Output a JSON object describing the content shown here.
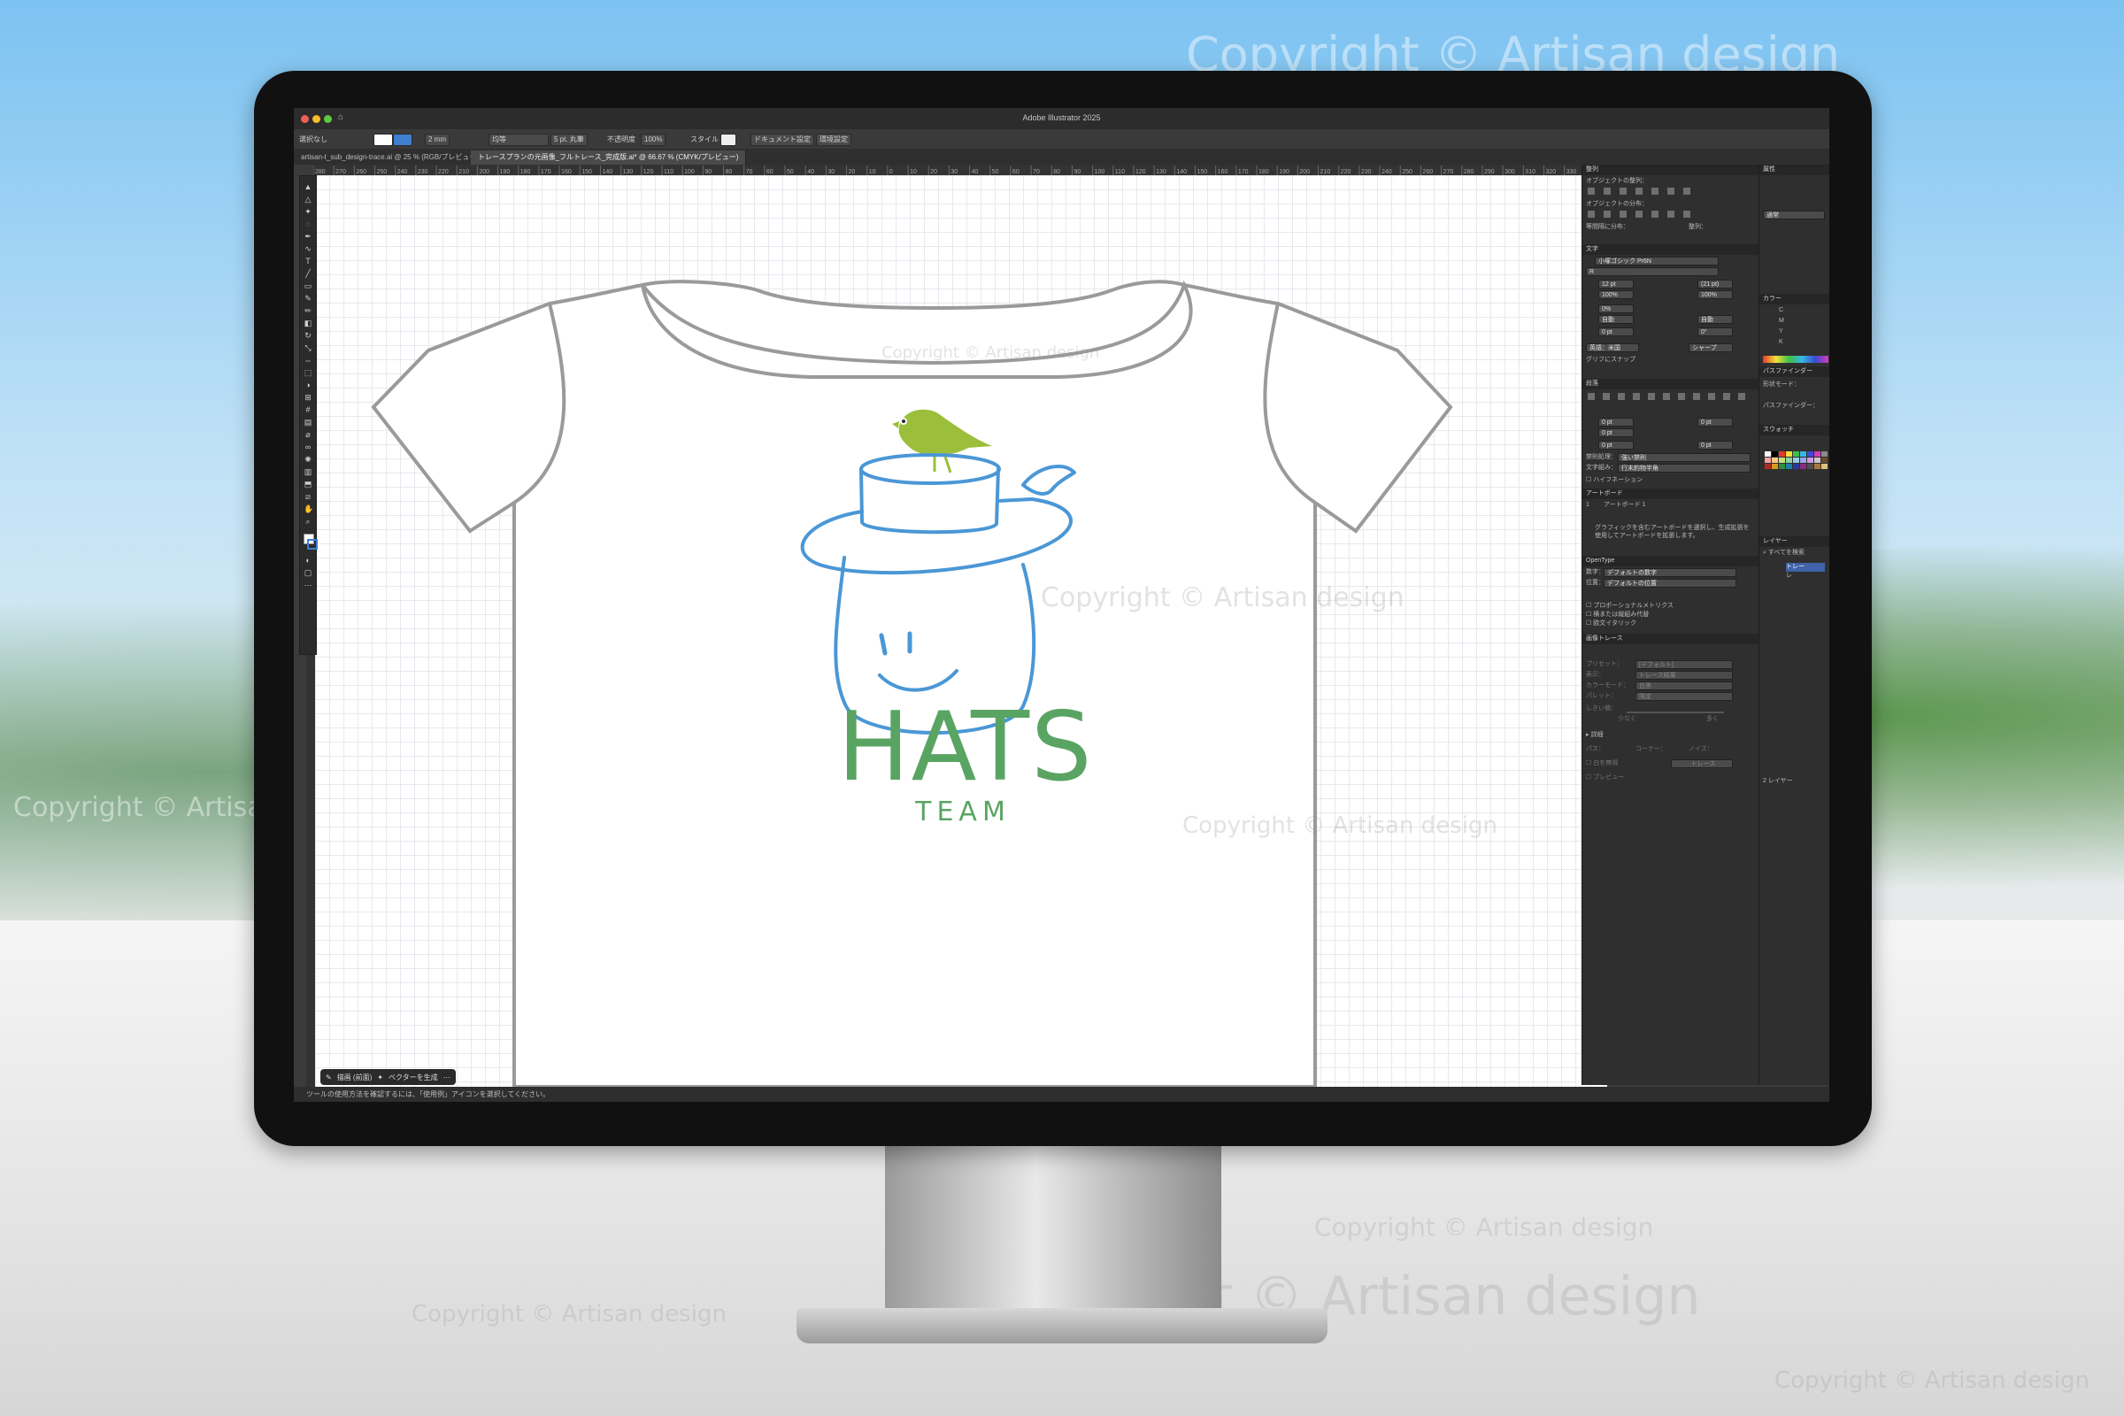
{
  "watermark": "Copyright © Artisan design",
  "app": {
    "window_title": "Adobe Illustrator 2025",
    "control_bar": {
      "selection": "選択なし",
      "stroke_weight": "2 mm",
      "stroke_style": "均等",
      "brush": "5 pt. 丸筆",
      "opacity_label": "不透明度",
      "opacity_value": "100%",
      "style_label": "スタイル",
      "doc_setup": "ドキュメント設定",
      "preferences": "環境設定"
    },
    "tabs": [
      {
        "label": "artisan-t_sub_design-trace.ai @ 25 % (RGB/プレビュー)"
      },
      {
        "label": "トレースプランの元画像_フルトレース_完成版.ai* @ 66.67 % (CMYK/プレビュー)"
      }
    ],
    "ruler_labels": [
      "280",
      "270",
      "260",
      "250",
      "240",
      "230",
      "220",
      "210",
      "200",
      "190",
      "180",
      "170",
      "160",
      "150",
      "140",
      "130",
      "120",
      "110",
      "100",
      "90",
      "80",
      "70",
      "60",
      "50",
      "40",
      "30",
      "20",
      "10",
      "0",
      "10",
      "20",
      "30",
      "40",
      "50",
      "60",
      "70",
      "80",
      "90",
      "100",
      "110",
      "120",
      "130",
      "140",
      "150",
      "160",
      "170",
      "180",
      "190",
      "200",
      "210",
      "220",
      "230",
      "240",
      "250",
      "260",
      "270",
      "280",
      "290",
      "300",
      "310",
      "320",
      "330",
      "340"
    ],
    "artwork": {
      "title_text": "HATS",
      "subtitle_text": "TEAM",
      "colors": {
        "shirt_outline": "#9a9a9a",
        "hat_blue": "#4a97d6",
        "bird_green": "#9bbf3b",
        "text_green": "#5aa463"
      }
    },
    "bottom_bar": {
      "draw_label": "描画 (前面)",
      "vector_label": "ベクターを生成"
    },
    "status_text": "ツールの使用方法を確認するには、「使用例」アイコンを選択してください。",
    "panels": {
      "align": {
        "header": "整列",
        "objects_align": "オブジェクトの整列：",
        "objects_distribute": "オブジェクトの分布：",
        "distribute_spacing": "等間隔に分布：",
        "align_to": "整列："
      },
      "character": {
        "header": "文字",
        "font": "小塚ゴシック Pr6N",
        "style": "R",
        "size": "12 pt",
        "leading": "(21 pt)",
        "vscale": "100%",
        "hscale": "100%",
        "tsume": "0%",
        "kerning": "自動",
        "tracking_auto": "自動",
        "baseline": "0 pt",
        "rotation": "0°",
        "language": "英語：米国",
        "aa": "シャープ",
        "glyph_snap": "グリフにスナップ"
      },
      "paragraph": {
        "header": "段落",
        "indent1": "0 pt",
        "indent2": "0 pt",
        "indent3": "0 pt",
        "space1": "0 pt",
        "space2": "0 pt",
        "kinsoku_label": "禁則処理：",
        "kinsoku_value": "強い禁則",
        "mojikumi_label": "文字組み：",
        "mojikumi_value": "行末約物半角",
        "hyphenation": "ハイフネーション"
      },
      "artboards": {
        "header": "アートボード",
        "item_num": "1",
        "item_name": "アートボード 1",
        "hint": "グラフィックを含むアートボードを選択し、生成拡張を使用してアートボードを拡張します。"
      },
      "opentype": {
        "header": "OpenType",
        "numeral_label": "数字：",
        "numeral_value": "デフォルトの数字",
        "position_label": "位置：",
        "position_value": "デフォルトの位置",
        "opt1": "プロポーショナルメトリクス",
        "opt2": "横または縦組み代替",
        "opt3": "欧文イタリック"
      },
      "image_trace": {
        "header": "画像トレース",
        "preset_label": "プリセット：",
        "preset_value": "[デフォルト]",
        "view_label": "表示：",
        "view_value": "トレース結果",
        "mode_label": "カラーモード：",
        "mode_value": "白黒",
        "palette_label": "パレット：",
        "palette_value": "限定",
        "threshold_label": "しきい値：",
        "low": "少なく",
        "high": "多く",
        "detail": "詳細",
        "paths": "パス：",
        "corner": "コーナー：",
        "noise": "ノイズ：",
        "group": "白を無視",
        "trace_btn": "トレース",
        "preview": "プレビュー"
      },
      "properties": {
        "header": "属性",
        "blend": "通常"
      },
      "color": {
        "header": "カラー",
        "c": "C",
        "m": "M",
        "y": "Y",
        "k": "K"
      },
      "pathfinder": {
        "header": "パスファインダー",
        "shape_mode": "形状モード：",
        "pathfinder": "パスファインダー："
      },
      "swatches": {
        "header": "スウォッチ"
      },
      "layers": {
        "header": "レイヤー",
        "search": "すべてを検索",
        "layer1": "トレー",
        "layer2": "レ",
        "count": "2 レイヤー"
      }
    }
  }
}
